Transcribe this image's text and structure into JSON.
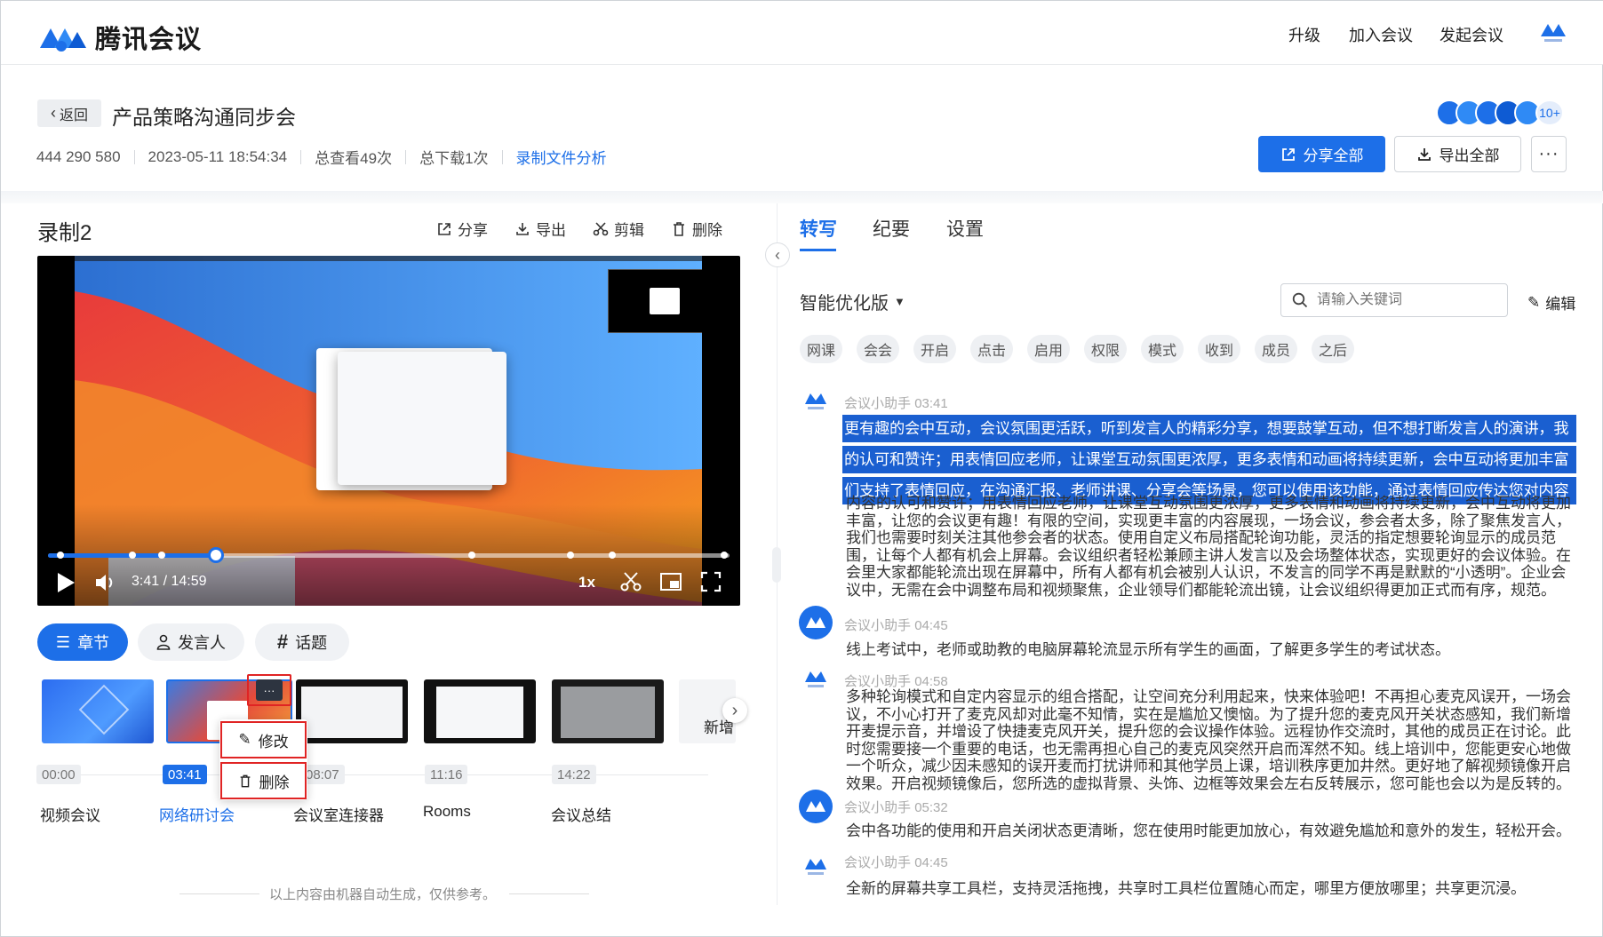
{
  "header": {
    "logo": "腾讯会议",
    "nav": [
      "升级",
      "加入会议",
      "发起会议"
    ]
  },
  "meeting": {
    "back": "返回",
    "title": "产品策略沟通同步会",
    "id": "444 290 580",
    "datetime": "2023-05-11 18:54:34",
    "views": "总查看49次",
    "downloads": "总下载1次",
    "analysis_link": "录制文件分析",
    "avatar_count": "10+",
    "share_all": "分享全部",
    "export_all": "导出全部"
  },
  "recording": {
    "title": "录制2",
    "tools": [
      "分享",
      "导出",
      "剪辑",
      "删除"
    ]
  },
  "player": {
    "time": "3:41 / 14:59",
    "speed": "1x",
    "progress": 0.246
  },
  "segments": {
    "tabs": [
      "章节",
      "发言人",
      "话题"
    ]
  },
  "chapters": [
    {
      "time": "00:00",
      "name": "视频会议"
    },
    {
      "time": "03:41",
      "name": "网络研讨会"
    },
    {
      "time": "08:07",
      "name": "会议室连接器"
    },
    {
      "time": "11:16",
      "name": "Rooms"
    },
    {
      "time": "14:22",
      "name": "会议总结"
    },
    {
      "time": "",
      "name": "新增"
    }
  ],
  "context_menu": {
    "edit": "修改",
    "delete": "删除"
  },
  "disclaimer": "以上内容由机器自动生成，仅供参考。",
  "right_tabs": [
    "转写",
    "纪要",
    "设置"
  ],
  "transcript": {
    "version": "智能优化版",
    "search_placeholder": "请输入关键词",
    "edit": "编辑",
    "tags": [
      "网课",
      "会会",
      "开启",
      "点击",
      "启用",
      "权限",
      "模式",
      "收到",
      "成员",
      "之后"
    ],
    "entries": [
      {
        "speaker": "会议小助手",
        "time": "03:41",
        "highlight": [
          "更有趣的会中互动，会议氛围更活跃，听到发言人的精彩分享，想要鼓掌互动，但不想打断发言人的演讲，我",
          "的认可和赞许；用表情回应老师，让课堂互动氛围更浓厚，更多表情和动画将持续更新，会中互动将更加丰富",
          "们支持了表情回应，在沟通汇报、老师讲课、分享会等场景，您可以使用该功能，通过表情回应传达您对内容"
        ],
        "text": [
          "内容的认可和赞许；用表情回应老师，让课堂互动氛围更浓厚，更多表情和动画将持续更新，会中互动将更加",
          "丰富，让您的会议更有趣！有限的空间，实现更丰富的内容展现，一场会议，参会者太多，除了聚焦发言人，",
          "我们也需要时刻关注其他参会者的状态。使用自定义布局搭配轮询功能，灵活的指定想要轮询显示的成员范",
          "围，让每个人都有机会上屏幕。会议组织者轻松兼顾主讲人发言以及会场整体状态，实现更好的会议体验。在",
          "会里大家都能轮流出现在屏幕中，所有人都有机会被别人认识，不发言的同学不再是默默的“小透明”。企业会",
          "议中，无需在会中调整布局和视频聚焦，企业领导们都能轮流出镜，让会议组织得更加正式而有序，规范。"
        ]
      },
      {
        "speaker": "会议小助手",
        "time": "04:45",
        "text": [
          "线上考试中，老师或助教的电脑屏幕轮流显示所有学生的画面，了解更多学生的考试状态。"
        ]
      },
      {
        "speaker": "会议小助手",
        "time": "04:58",
        "text": [
          "多种轮询模式和自定内容显示的组合搭配，让空间充分利用起来，快来体验吧！不再担心麦克风误开，一场会",
          "议，不小心打开了麦克风却对此毫不知情，实在是尴尬又懊恼。为了提升您的麦克风开关状态感知，我们新增",
          "开麦提示音，并增设了快捷麦克风开关，提升您的会议操作体验。远程协作交流时，其他的成员正在讨论。此",
          "时您需要接一个重要的电话，也无需再担心自己的麦克风突然开启而浑然不知。线上培训中，您能更安心地做",
          "一个听众，减少因未感知的误开麦而打扰讲师和其他学员上课，培训秩序更加井然。更好地了解视频镜像开启",
          "效果。开启视频镜像后，您所选的虚拟背景、头饰、边框等效果会左右反转展示，您可能也会以为是反转的。"
        ]
      },
      {
        "speaker": "会议小助手",
        "time": "05:32",
        "text": [
          "会中各功能的使用和开启关闭状态更清晰，您在使用时能更加放心，有效避免尴尬和意外的发生，轻松开会。"
        ]
      },
      {
        "speaker": "会议小助手",
        "time": "04:45",
        "text": [
          "全新的屏幕共享工具栏，支持灵活拖拽，共享时工具栏位置随心而定，哪里方便放哪里；共享更沉浸。"
        ]
      }
    ]
  },
  "colors": {
    "brand": "#1d6fe8",
    "highlight": "#1a5fd0",
    "alert": "#e02424"
  }
}
